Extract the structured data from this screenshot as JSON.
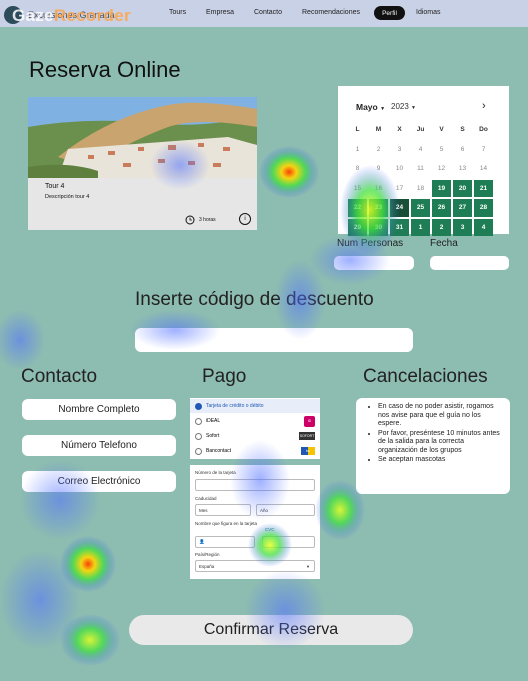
{
  "overlay": {
    "watermark_a": "Gaze",
    "watermark_b": "Recorder"
  },
  "nav": {
    "brand": "Excursiones Granada",
    "links": [
      "Tours",
      "Empresa",
      "Contacto",
      "Recomendaciones",
      "Perfil",
      "Idiomas"
    ],
    "active": "Perfil"
  },
  "page": {
    "title": "Reserva Online"
  },
  "tour": {
    "name": "Tour 4",
    "description": "Descripción tour 4",
    "duration": "3 horas",
    "info_icon": "i"
  },
  "calendar": {
    "month": "Mayo",
    "year": "2023",
    "next_icon": "›",
    "weekdays": [
      "L",
      "M",
      "X",
      "Ju",
      "V",
      "S",
      "Do"
    ],
    "weeks": [
      [
        "1",
        "2",
        "3",
        "4",
        "5",
        "6",
        "7"
      ],
      [
        "8",
        "9",
        "10",
        "11",
        "12",
        "13",
        "14"
      ],
      [
        "15",
        "16",
        "17",
        "18",
        "19",
        "20",
        "21"
      ],
      [
        "22",
        "23",
        "24",
        "25",
        "26",
        "27",
        "28"
      ],
      [
        "29",
        "30",
        "31",
        "1",
        "2",
        "3",
        "4"
      ]
    ],
    "available_from": "19",
    "selected": "24",
    "colors": {
      "available": "#1f7d55",
      "selected": "#174f37"
    }
  },
  "booking": {
    "persons_label": "Num Personas",
    "date_label": "Fecha"
  },
  "discount": {
    "label": "Inserte código de descuento"
  },
  "contact": {
    "heading": "Contacto",
    "fields": [
      "Nombre Completo",
      "Número Telefono",
      "Correo Electrónico"
    ]
  },
  "payment": {
    "heading": "Pago",
    "methods": [
      {
        "label": "Tarjeta de crédito o débito",
        "logo": ""
      },
      {
        "label": "iDEAL",
        "logo": "iD"
      },
      {
        "label": "Sofort",
        "logo": "SOFORT"
      },
      {
        "label": "Bancontact",
        "logo": "bc"
      }
    ],
    "card_number_label": "Número de la tarjeta",
    "expiry_label": "Caducidad",
    "month_placeholder": "Mes",
    "year_placeholder": "Año",
    "holder_label": "Nombre que figura en la tarjeta",
    "cvc_label": "CVC",
    "country_label": "País/Región",
    "country_value": "España"
  },
  "cancellations": {
    "heading": "Cancelaciones",
    "items": [
      "En caso de no poder asistir, rogamos nos avise para que el guía no los espere.",
      "Por favor, preséntese 10 minutos antes de la salida para la correcta organización de los grupos",
      "Se aceptan mascotas"
    ]
  },
  "confirm": {
    "label": "Confirmar Reserva"
  }
}
